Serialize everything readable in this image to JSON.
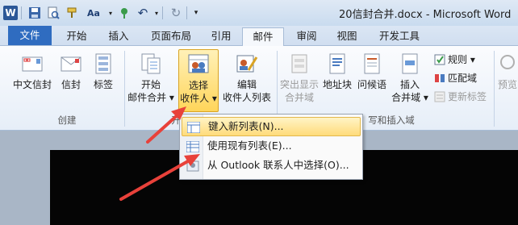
{
  "window": {
    "title": "20信封合并.docx  -  Microsoft Word"
  },
  "qat": {
    "font_size_label": "Aa"
  },
  "tabs": [
    {
      "label": "文件"
    },
    {
      "label": "开始"
    },
    {
      "label": "插入"
    },
    {
      "label": "页面布局"
    },
    {
      "label": "引用"
    },
    {
      "label": "邮件"
    },
    {
      "label": "审阅"
    },
    {
      "label": "视图"
    },
    {
      "label": "开发工具"
    }
  ],
  "ribbon": {
    "create": {
      "label": "创建",
      "chinese_envelope": "中文信封",
      "envelope": "信封",
      "labels": "标签"
    },
    "start_merge": {
      "label_partial": "开",
      "start_mail_merge_line1": "开始",
      "start_mail_merge_line2": "邮件合并",
      "select_recipients_line1": "选择",
      "select_recipients_line2": "收件人",
      "edit_list_line1": "编辑",
      "edit_list_line2": "收件人列表"
    },
    "write_insert": {
      "label_partial": "写和插入域",
      "highlight_merge_line1": "突出显示",
      "highlight_merge_line2": "合并域",
      "address_block": "地址块",
      "greeting": "问候语",
      "insert_merge_line1": "插入",
      "insert_merge_line2": "合并域",
      "rules": "规则",
      "match_fields": "匹配域",
      "update_labels": "更新标签"
    },
    "preview": {
      "label_partial": "预览"
    }
  },
  "menu": {
    "items": [
      {
        "label": "键入新列表(N)..."
      },
      {
        "label": "使用现有列表(E)..."
      },
      {
        "label": "从 Outlook 联系人中选择(O)..."
      }
    ]
  },
  "colors": {
    "file_tab": "#2f6cc0",
    "highlight": "#ffd55a",
    "arrow": "#e8413a"
  }
}
